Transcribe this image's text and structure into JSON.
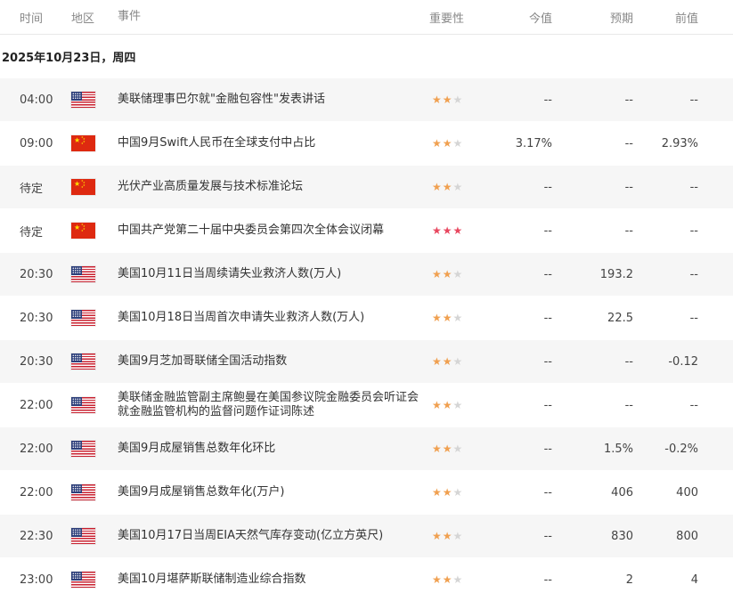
{
  "header": {
    "time": "时间",
    "region": "地区",
    "event": "事件",
    "importance": "重要性",
    "actual": "今值",
    "forecast": "预期",
    "previous": "前值"
  },
  "date_label": "2025年10月23日，周四",
  "colors": {
    "star_on": "#f0a050",
    "star_off": "#d5d5d5",
    "star_high": "#e8475f",
    "row_shade": "#f6f6f6"
  },
  "rows": [
    {
      "time": "04:00",
      "flag": "us-flag-icon",
      "event": "美联储理事巴尔就\"金融包容性\"发表讲话",
      "importance": 2,
      "actual": "--",
      "forecast": "--",
      "previous": "--"
    },
    {
      "time": "09:00",
      "flag": "cn-flag-icon",
      "event": "中国9月Swift人民币在全球支付中占比",
      "importance": 2,
      "actual": "3.17%",
      "forecast": "--",
      "previous": "2.93%"
    },
    {
      "time": "待定",
      "flag": "cn-flag-icon",
      "event": "光伏产业高质量发展与技术标准论坛",
      "importance": 2,
      "actual": "--",
      "forecast": "--",
      "previous": "--"
    },
    {
      "time": "待定",
      "flag": "cn-flag-icon",
      "event": "中国共产党第二十届中央委员会第四次全体会议闭幕",
      "importance": 3,
      "actual": "--",
      "forecast": "--",
      "previous": "--"
    },
    {
      "time": "20:30",
      "flag": "us-flag-icon",
      "event": "美国10月11日当周续请失业救济人数(万人)",
      "importance": 2,
      "actual": "--",
      "forecast": "193.2",
      "previous": "--"
    },
    {
      "time": "20:30",
      "flag": "us-flag-icon",
      "event": "美国10月18日当周首次申请失业救济人数(万人)",
      "importance": 2,
      "actual": "--",
      "forecast": "22.5",
      "previous": "--"
    },
    {
      "time": "20:30",
      "flag": "us-flag-icon",
      "event": "美国9月芝加哥联储全国活动指数",
      "importance": 2,
      "actual": "--",
      "forecast": "--",
      "previous": "-0.12"
    },
    {
      "time": "22:00",
      "flag": "us-flag-icon",
      "event": "美联储金融监管副主席鲍曼在美国参议院金融委员会听证会就金融监管机构的监督问题作证词陈述",
      "importance": 2,
      "actual": "--",
      "forecast": "--",
      "previous": "--"
    },
    {
      "time": "22:00",
      "flag": "us-flag-icon",
      "event": "美国9月成屋销售总数年化环比",
      "importance": 2,
      "actual": "--",
      "forecast": "1.5%",
      "previous": "-0.2%"
    },
    {
      "time": "22:00",
      "flag": "us-flag-icon",
      "event": "美国9月成屋销售总数年化(万户)",
      "importance": 2,
      "actual": "--",
      "forecast": "406",
      "previous": "400"
    },
    {
      "time": "22:30",
      "flag": "us-flag-icon",
      "event": "美国10月17日当周EIA天然气库存变动(亿立方英尺)",
      "importance": 2,
      "actual": "--",
      "forecast": "830",
      "previous": "800"
    },
    {
      "time": "23:00",
      "flag": "us-flag-icon",
      "event": "美国10月堪萨斯联储制造业综合指数",
      "importance": 2,
      "actual": "--",
      "forecast": "2",
      "previous": "4"
    }
  ]
}
